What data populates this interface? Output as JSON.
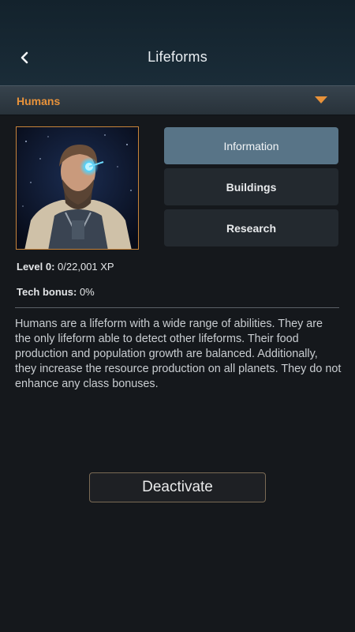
{
  "header": {
    "title": "Lifeforms"
  },
  "selector": {
    "label": "Humans",
    "accent": "#e8923a"
  },
  "tabs": [
    {
      "label": "Information",
      "active": true
    },
    {
      "label": "Buildings",
      "active": false
    },
    {
      "label": "Research",
      "active": false
    }
  ],
  "stats": {
    "level_key": "Level 0:",
    "level_value": "0/22,001 XP",
    "tech_key": "Tech bonus:",
    "tech_value": "0%"
  },
  "description": "Humans are a lifeform with a wide range of abilities. They are the only lifeform able to detect other lifeforms. Their food production and population growth are balanced. Additionally, they increase the resource production on all planets. They do not enhance any class bonuses.",
  "actions": {
    "deactivate_label": "Deactivate"
  },
  "icons": {
    "back": "chevron-left-icon",
    "dropdown": "caret-down-icon"
  }
}
